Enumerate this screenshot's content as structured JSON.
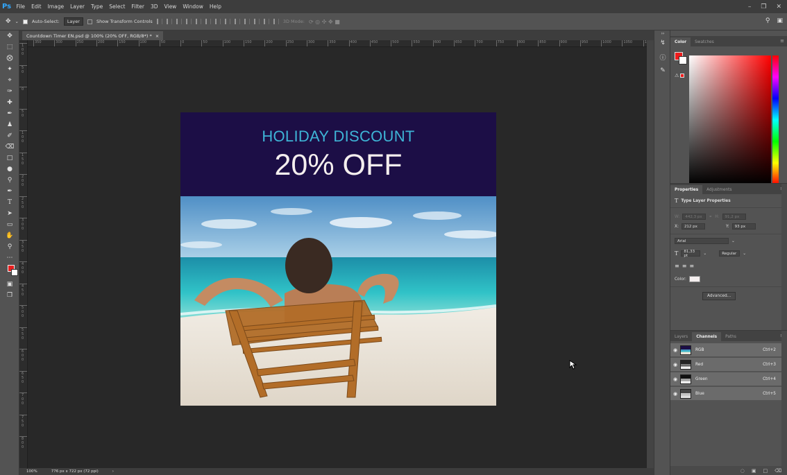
{
  "menu": [
    "File",
    "Edit",
    "Image",
    "Layer",
    "Type",
    "Select",
    "Filter",
    "3D",
    "View",
    "Window",
    "Help"
  ],
  "app_logo": "Ps",
  "options": {
    "auto_select_label": "Auto-Select:",
    "auto_select_value": "Layer",
    "show_transform_label": "Show Transform Controls",
    "mode_3d_label": "3D Mode:"
  },
  "document": {
    "tab_title": "Countdown Timer EN.psd @ 100% (20% OFF, RGB/8*) *",
    "close": "×"
  },
  "ruler_h": [
    "350",
    "300",
    "250",
    "200",
    "150",
    "100",
    "50",
    "0",
    "50",
    "100",
    "150",
    "200",
    "250",
    "300",
    "350",
    "400",
    "450",
    "500",
    "550",
    "600",
    "650",
    "700",
    "750",
    "800",
    "850",
    "900",
    "950",
    "1000",
    "1050",
    "1100"
  ],
  "ruler_v": [
    "1 0 0",
    "5 0",
    "0",
    "5 0",
    "1 0 0",
    "1 5 0",
    "2 0 0",
    "2 5 0",
    "3 0 0",
    "3 5 0",
    "4 0 0",
    "4 5 0",
    "5 0 0",
    "5 5 0",
    "6 0 0",
    "6 5 0",
    "7 0 0",
    "7 5 0",
    "8 0 0"
  ],
  "artwork": {
    "headline": "HOLIDAY DISCOUNT",
    "offer": "20% OFF",
    "headline_color": "#3eb4d6",
    "banner_color": "#1c0e46"
  },
  "status": {
    "zoom": "100%",
    "doc_size": "776 px x 722 px (72 ppi)",
    "arrow": "›"
  },
  "color_panel": {
    "tabs": [
      "Color",
      "Swatches"
    ],
    "fg_color": "#ee1c1c",
    "bg_color": "#ffffff"
  },
  "properties": {
    "tabs": [
      "Properties",
      "Adjustments"
    ],
    "title": "Type Layer Properties",
    "w_label": "W:",
    "w_value": "442,3 px",
    "h_label": "H:",
    "h_value": "91,2 px",
    "x_label": "X:",
    "x_value": "212 px",
    "y_label": "Y:",
    "y_value": "93 px",
    "font": "Arial",
    "size": "81,33 pt",
    "style": "Regular",
    "color_label": "Color:",
    "advanced": "Advanced..."
  },
  "channels": {
    "tabs": [
      "Layers",
      "Channels",
      "Paths"
    ],
    "rows": [
      {
        "name": "RGB",
        "key": "Ctrl+2"
      },
      {
        "name": "Red",
        "key": "Ctrl+3"
      },
      {
        "name": "Green",
        "key": "Ctrl+4"
      },
      {
        "name": "Blue",
        "key": "Ctrl+5"
      }
    ]
  }
}
